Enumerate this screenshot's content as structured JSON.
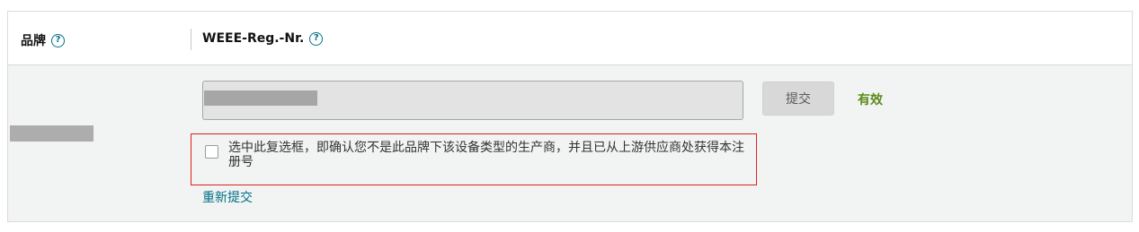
{
  "header": {
    "brand_label": "品牌",
    "brand_help": "?",
    "weee_label": "WEEE-Reg.-Nr.",
    "weee_help": "?"
  },
  "row": {
    "brand_value": "",
    "registration_number": "",
    "submit_label": "提交",
    "status": "有效",
    "confirm_text": "选中此复选框，即确认您不是此品牌下该设备类型的生产商，并且已从上游供应商处获得本注册号",
    "confirm_checked": false,
    "resubmit_label": "重新提交"
  },
  "colors": {
    "link": "#007185",
    "status_valid": "#5a8a1c",
    "highlight_border": "#e02020",
    "row_background": "#f2f3f3"
  }
}
